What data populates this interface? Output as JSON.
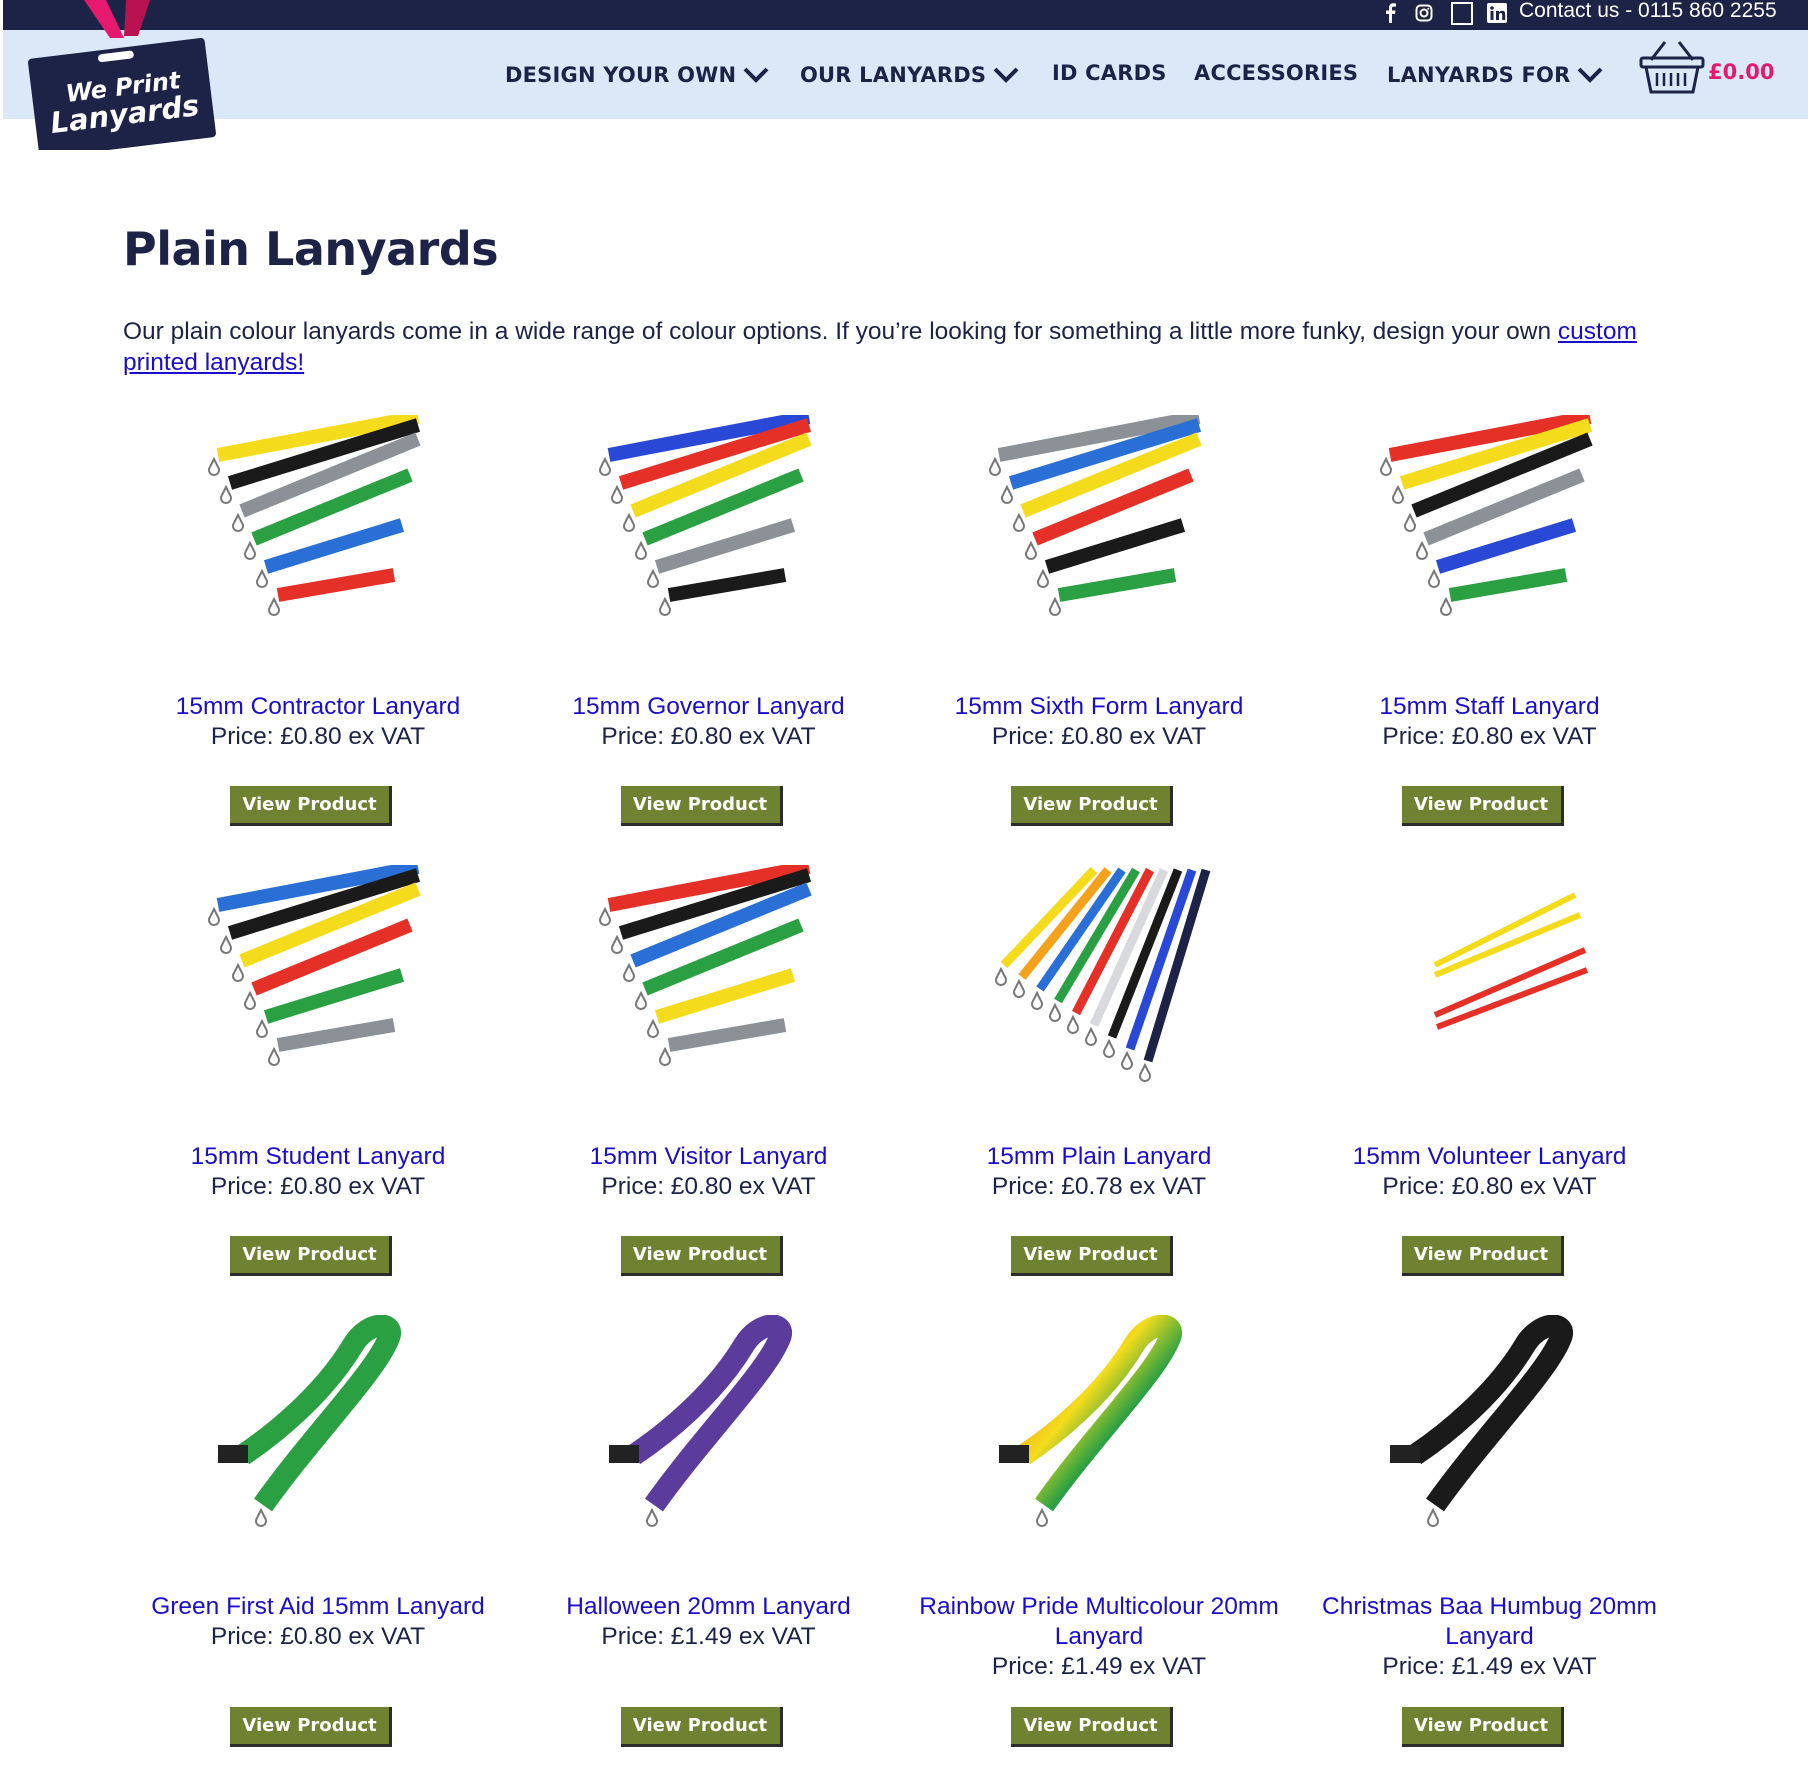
{
  "topbar": {
    "contact": "Contact us - 0115 860 2255",
    "social": [
      "facebook-icon",
      "instagram-icon",
      "blank-icon",
      "linkedin-icon"
    ]
  },
  "logo": {
    "line1": "We Print",
    "line2": "Lanyards"
  },
  "nav": {
    "design_your_own": "DESIGN YOUR OWN",
    "our_lanyards": "OUR LANYARDS",
    "id_cards": "ID CARDS",
    "accessories": "ACCESSORIES",
    "lanyards_for": "LANYARDS FOR",
    "cart_total": "£0.00"
  },
  "colors": {
    "navy": "#1d2347",
    "nav_bg": "#dae8f8",
    "pink": "#e5196d",
    "button_green": "#6f8232",
    "link_blue": "#1a0dcc"
  },
  "page": {
    "title": "Plain Lanyards",
    "intro": "Our plain colour lanyards come in a wide range of colour options. If you’re looking for something a little more funky, design your own ",
    "intro_link": "custom printed lanyards!"
  },
  "products": [
    {
      "title": "15mm Contractor Lanyard",
      "price": "Price: £0.80 ex VAT",
      "button": "View Product",
      "image": "contractor-lanyards-image"
    },
    {
      "title": "15mm Governor Lanyard",
      "price": "Price: £0.80 ex VAT",
      "button": "View Product",
      "image": "governor-lanyards-image"
    },
    {
      "title": "15mm Sixth Form Lanyard",
      "price": "Price: £0.80 ex VAT",
      "button": "View Product",
      "image": "sixth-form-lanyards-image"
    },
    {
      "title": "15mm Staff Lanyard",
      "price": "Price: £0.80 ex VAT",
      "button": "View Product",
      "image": "staff-lanyards-image"
    },
    {
      "title": "15mm Student Lanyard",
      "price": "Price: £0.80 ex VAT",
      "button": "View Product",
      "image": "student-lanyards-image"
    },
    {
      "title": "15mm Visitor Lanyard",
      "price": "Price: £0.80 ex VAT",
      "button": "View Product",
      "image": "visitor-lanyards-image"
    },
    {
      "title": "15mm Plain Lanyard",
      "price": "Price: £0.78 ex VAT",
      "button": "View Product",
      "image": "plain-lanyards-image"
    },
    {
      "title": "15mm Volunteer Lanyard",
      "price": "Price: £0.80 ex VAT",
      "button": "View Product",
      "image": "volunteer-lanyards-image"
    },
    {
      "title": "Green First Aid 15mm Lanyard",
      "price": "Price: £0.80 ex VAT",
      "button": "View Product",
      "image": "first-aid-lanyard-image"
    },
    {
      "title": "Halloween 20mm Lanyard",
      "price": "Price: £1.49 ex VAT",
      "button": "View Product",
      "image": "halloween-lanyard-image"
    },
    {
      "title": "Rainbow Pride Multicolour 20mm Lanyard",
      "price": "Price: £1.49 ex VAT",
      "button": "View Product",
      "image": "rainbow-lanyard-image"
    },
    {
      "title": "Christmas Baa Humbug 20mm Lanyard",
      "price": "Price: £1.49 ex VAT",
      "button": "View Product",
      "image": "christmas-lanyard-image"
    }
  ]
}
